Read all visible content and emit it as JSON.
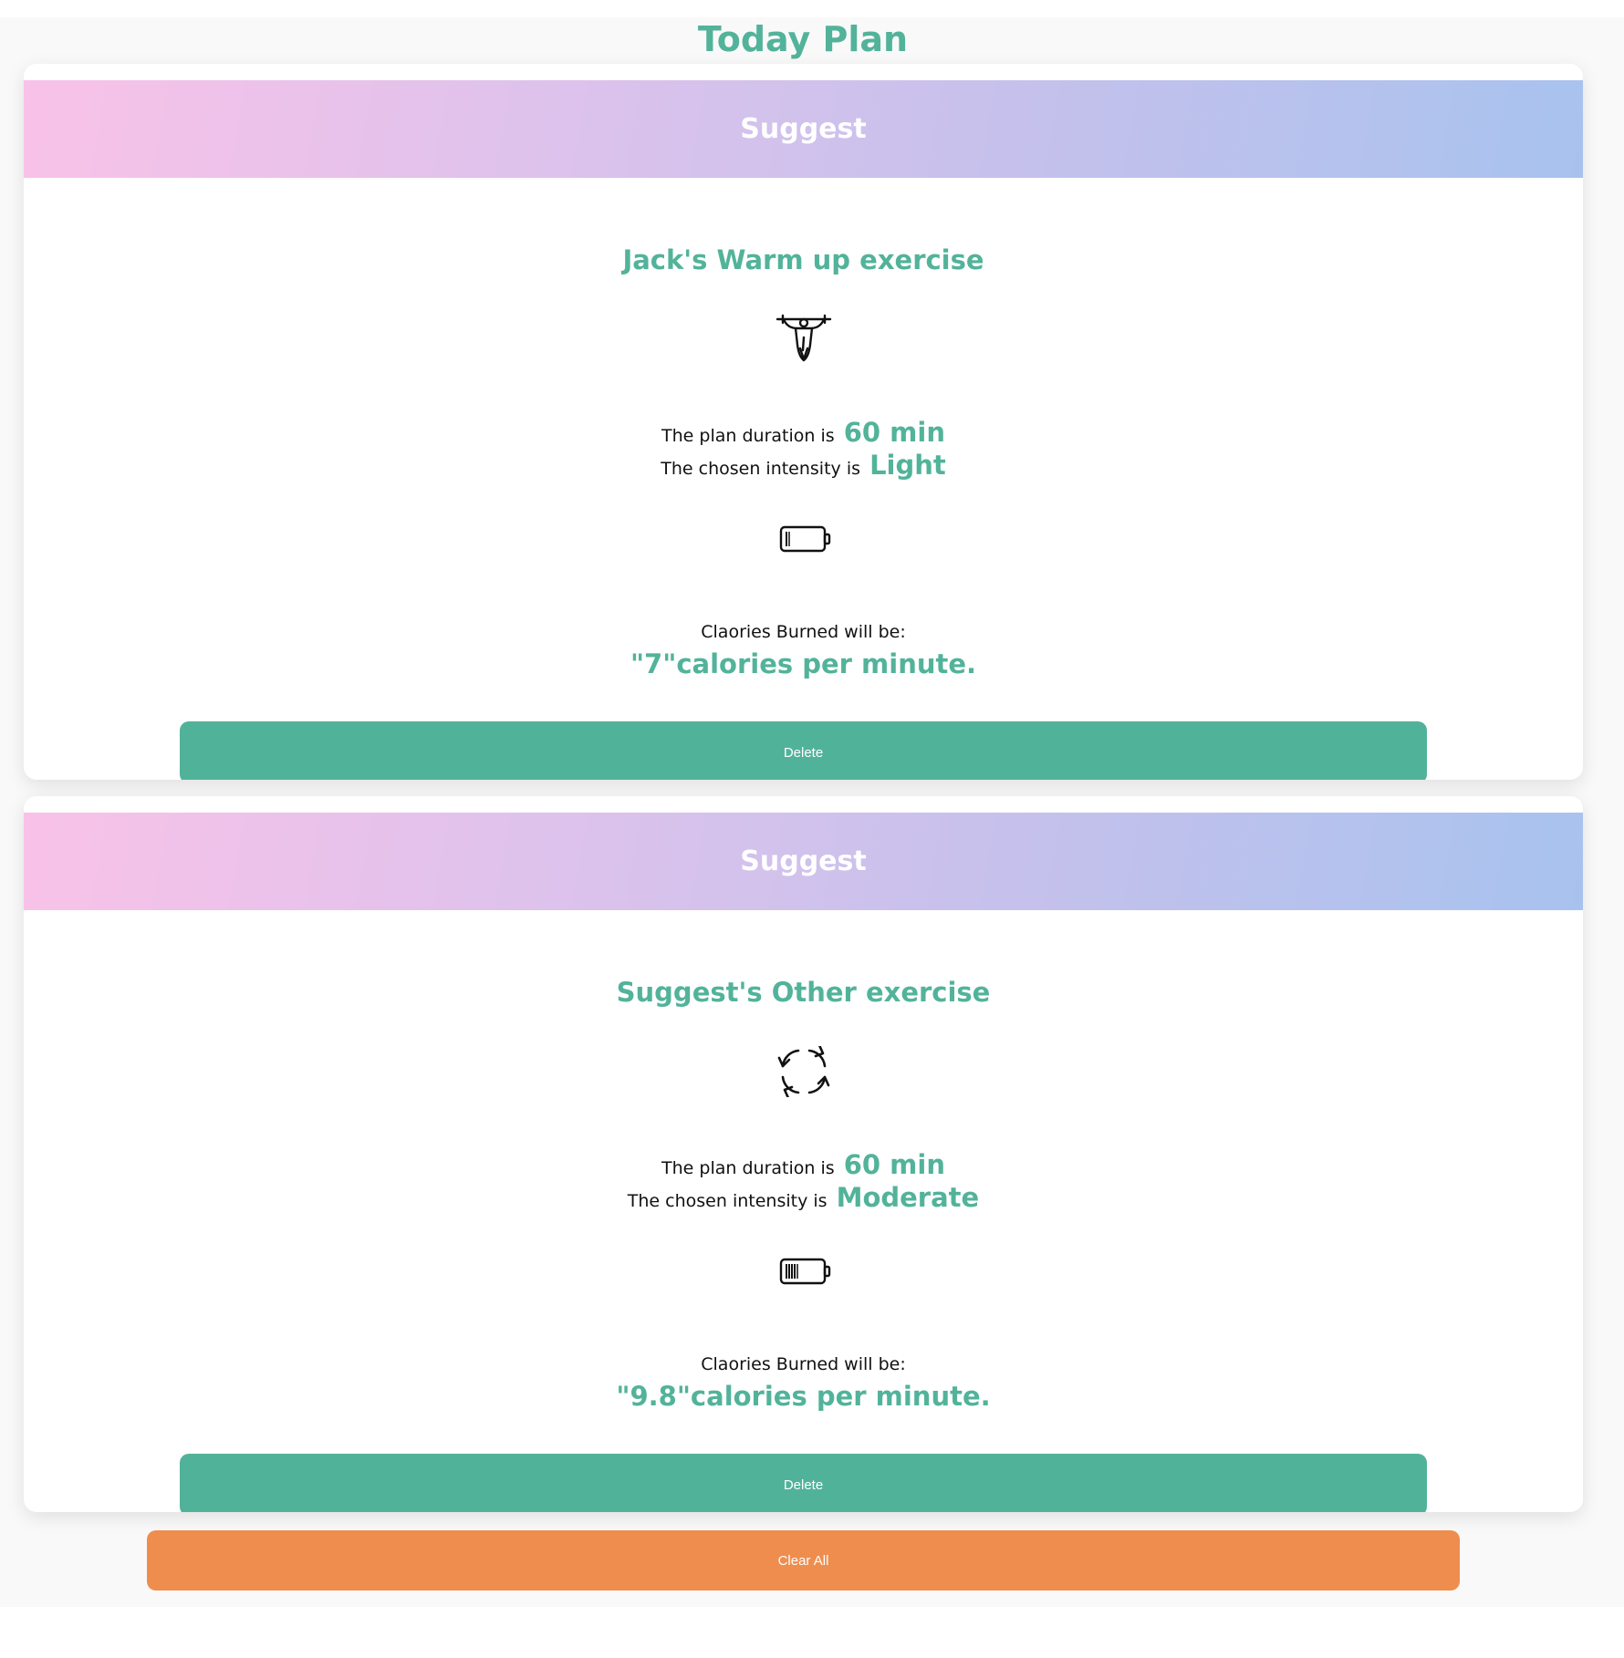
{
  "page": {
    "title": "Today Plan"
  },
  "plans": [
    {
      "header": "Suggest",
      "exercise_name": "Jack's Warm up exercise",
      "exercise_icon": "pull-up-icon",
      "duration_prefix": "The plan duration is",
      "duration_value": "60 min",
      "intensity_prefix": "The chosen intensity is",
      "intensity_value": "Light",
      "battery_icon": "battery-low-icon",
      "battery_level": 0.1,
      "calories_label": "Claories Burned will be:",
      "calories_value": "\"7\"calories per minute.",
      "delete_label": "Delete"
    },
    {
      "header": "Suggest",
      "exercise_name": "Suggest's Other exercise",
      "exercise_icon": "refresh-cycle-icon",
      "duration_prefix": "The plan duration is",
      "duration_value": "60 min",
      "intensity_prefix": "The chosen intensity is",
      "intensity_value": "Moderate",
      "battery_icon": "battery-medium-icon",
      "battery_level": 0.35,
      "calories_label": "Claories Burned will be:",
      "calories_value": "\"9.8\"calories per minute.",
      "delete_label": "Delete"
    }
  ],
  "actions": {
    "clear_all_label": "Clear All"
  },
  "colors": {
    "accent": "#52b39a",
    "clear_button": "#ef8d4f",
    "header_gradient_start": "#f9c2e8",
    "header_gradient_end": "#a8c2ee"
  }
}
